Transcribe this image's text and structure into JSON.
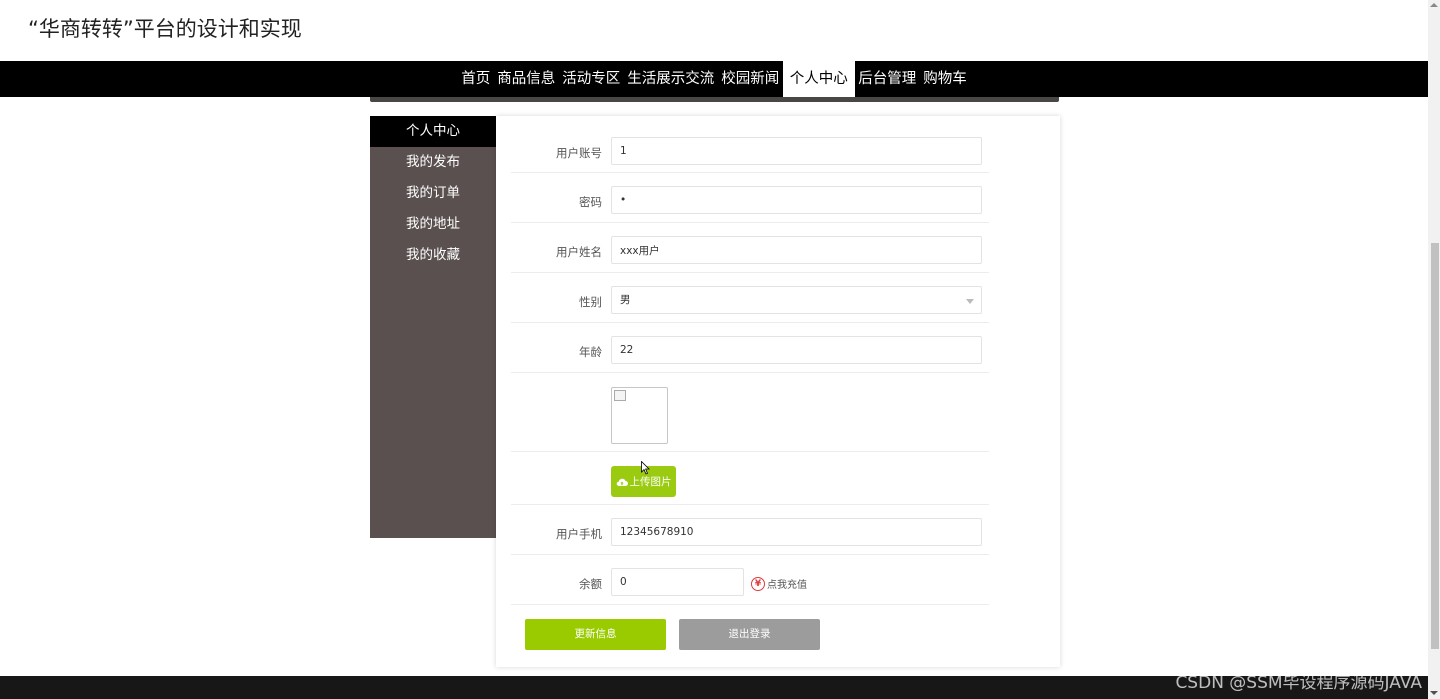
{
  "site": {
    "title": "“华商转转”平台的设计和实现"
  },
  "nav": {
    "items": [
      {
        "label": "首页"
      },
      {
        "label": "商品信息"
      },
      {
        "label": "活动专区"
      },
      {
        "label": "生活展示交流"
      },
      {
        "label": "校园新闻"
      },
      {
        "label": "个人中心",
        "active": true
      },
      {
        "label": "后台管理"
      },
      {
        "label": "购物车"
      }
    ]
  },
  "sidebar": {
    "items": [
      {
        "label": "个人中心",
        "active": true
      },
      {
        "label": "我的发布"
      },
      {
        "label": "我的订单"
      },
      {
        "label": "我的地址"
      },
      {
        "label": "我的收藏"
      }
    ]
  },
  "form": {
    "account": {
      "label": "用户账号",
      "value": "1"
    },
    "password": {
      "label": "密码",
      "value": "•"
    },
    "name": {
      "label": "用户姓名",
      "value": "xxx用户"
    },
    "gender": {
      "label": "性别",
      "value": "男"
    },
    "age": {
      "label": "年龄",
      "value": "22"
    },
    "upload_label": "上传图片",
    "phone": {
      "label": "用户手机",
      "value": "12345678910"
    },
    "balance": {
      "label": "余额",
      "value": "0"
    },
    "recharge_symbol": "¥",
    "recharge_label": "点我充值",
    "update_label": "更新信息",
    "logout_label": "退出登录"
  },
  "watermark": "CSDN @SSM毕设程序源码JAVA",
  "colors": {
    "accent_green": "#9acb00",
    "nav_bg": "#000000",
    "sidebar_bg": "#5a5050",
    "logout_gray": "#9c9c9c",
    "recharge_red": "#e03a3a"
  }
}
